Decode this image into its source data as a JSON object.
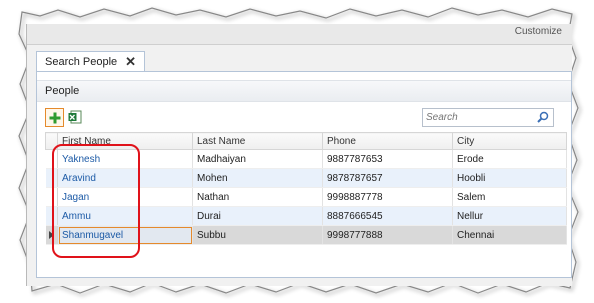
{
  "app": {
    "customize_label": "Customize"
  },
  "tabs": [
    {
      "label": "Search People",
      "close_glyph": "✕"
    }
  ],
  "section": {
    "title": "People"
  },
  "toolbar": {
    "add_icon": "add-icon",
    "excel_icon": "excel-export-icon"
  },
  "search": {
    "placeholder": "Search",
    "value": ""
  },
  "grid": {
    "columns": [
      "First Name",
      "Last Name",
      "Phone",
      "City"
    ],
    "rows": [
      {
        "first_name": "Yaknesh",
        "last_name": "Madhaiyan",
        "phone": "9887787653",
        "city": "Erode"
      },
      {
        "first_name": "Aravind",
        "last_name": "Mohen",
        "phone": "9878787657",
        "city": "Hoobli"
      },
      {
        "first_name": "Jagan",
        "last_name": "Nathan",
        "phone": "9998887778",
        "city": "Salem"
      },
      {
        "first_name": "Ammu",
        "last_name": "Durai",
        "phone": "8887666545",
        "city": "Nellur"
      },
      {
        "first_name": "Shanmugavel",
        "last_name": "Subbu",
        "phone": "9998777888",
        "city": "Chennai"
      }
    ]
  },
  "colors": {
    "accent": "#1c5aa6",
    "selection_outline": "#e58a2c",
    "annotation_red": "#e0121a"
  }
}
